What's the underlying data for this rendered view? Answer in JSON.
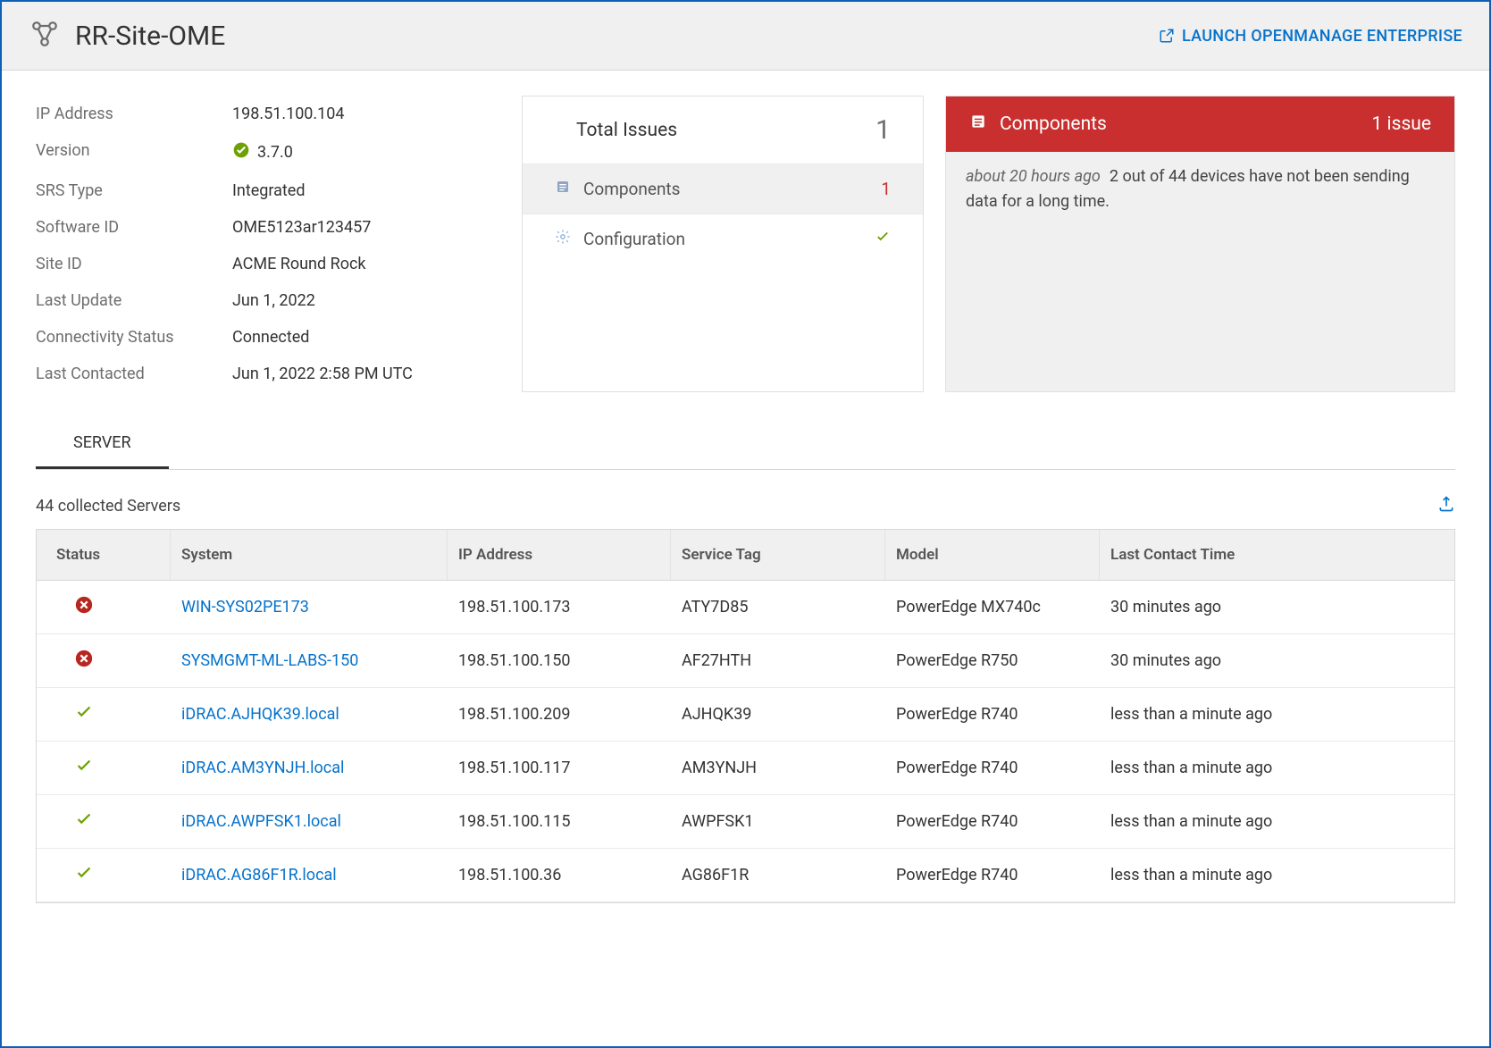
{
  "header": {
    "title": "RR-Site-OME",
    "launch_label": "LAUNCH OPENMANAGE ENTERPRISE"
  },
  "props": {
    "ip_label": "IP Address",
    "ip": "198.51.100.104",
    "version_label": "Version",
    "version": "3.7.0",
    "srs_label": "SRS Type",
    "srs": "Integrated",
    "swid_label": "Software ID",
    "swid": "OME5123ar123457",
    "site_label": "Site ID",
    "site": "ACME Round Rock",
    "lastupd_label": "Last Update",
    "lastupd": "Jun 1, 2022",
    "conn_label": "Connectivity Status",
    "conn": "Connected",
    "lastcontact_label": "Last Contacted",
    "lastcontact": "Jun 1, 2022 2:58 PM UTC"
  },
  "summary": {
    "total_label": "Total Issues",
    "total_count": "1",
    "components_label": "Components",
    "components_count": "1",
    "configuration_label": "Configuration"
  },
  "detail": {
    "title": "Components",
    "badge": "1 issue",
    "time": "about 20 hours ago",
    "text": "2 out of 44 devices have not been sending data for a long time."
  },
  "tab": {
    "server": "SERVER"
  },
  "servers": {
    "count_text": "44 collected Servers",
    "columns": {
      "status": "Status",
      "system": "System",
      "ip": "IP Address",
      "tag": "Service Tag",
      "model": "Model",
      "time": "Last Contact Time"
    },
    "rows": [
      {
        "status": "error",
        "system": "WIN-SYS02PE173",
        "ip": "198.51.100.173",
        "tag": "ATY7D85",
        "model": "PowerEdge MX740c",
        "time": "30 minutes ago"
      },
      {
        "status": "error",
        "system": "SYSMGMT-ML-LABS-150",
        "ip": "198.51.100.150",
        "tag": "AF27HTH",
        "model": "PowerEdge R750",
        "time": "30 minutes ago"
      },
      {
        "status": "ok",
        "system": "iDRAC.AJHQK39.local",
        "ip": "198.51.100.209",
        "tag": "AJHQK39",
        "model": "PowerEdge R740",
        "time": "less than a minute ago"
      },
      {
        "status": "ok",
        "system": "iDRAC.AM3YNJH.local",
        "ip": "198.51.100.117",
        "tag": "AM3YNJH",
        "model": "PowerEdge R740",
        "time": "less than a minute ago"
      },
      {
        "status": "ok",
        "system": "iDRAC.AWPFSK1.local",
        "ip": "198.51.100.115",
        "tag": "AWPFSK1",
        "model": "PowerEdge R740",
        "time": "less than a minute ago"
      },
      {
        "status": "ok",
        "system": "iDRAC.AG86F1R.local",
        "ip": "198.51.100.36",
        "tag": "AG86F1R",
        "model": "PowerEdge R740",
        "time": "less than a minute ago"
      }
    ]
  }
}
